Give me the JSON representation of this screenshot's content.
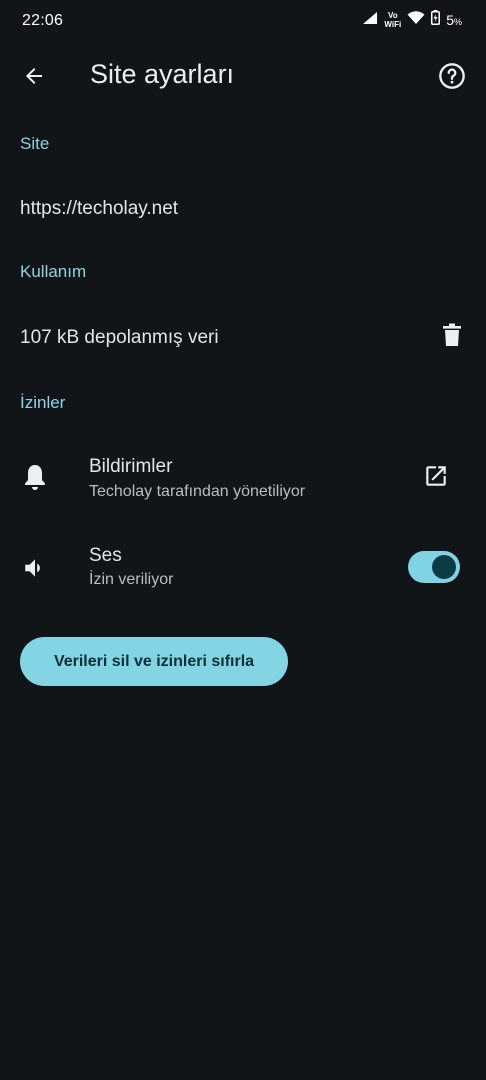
{
  "status_bar": {
    "time": "22:06",
    "vowifi_top": "Vo",
    "vowifi_bottom": "WiFi",
    "battery": "5",
    "battery_unit": "%"
  },
  "app_bar": {
    "title": "Site ayarları"
  },
  "site_section": {
    "header": "Site",
    "url": "https://techolay.net"
  },
  "usage_section": {
    "header": "Kullanım",
    "storage": "107 kB depolanmış veri"
  },
  "permissions_section": {
    "header": "İzinler",
    "items": [
      {
        "title": "Bildirimler",
        "subtitle": "Techolay tarafından yönetiliyor",
        "icon": "bell-icon"
      },
      {
        "title": "Ses",
        "subtitle": "İzin veriliyor",
        "icon": "volume-icon",
        "toggle_on": true
      }
    ]
  },
  "reset_button": {
    "label": "Verileri sil ve izinleri sıfırla"
  },
  "colors": {
    "background": "#121518",
    "accent": "#84d5e4",
    "section_header": "#8fd3e3"
  }
}
